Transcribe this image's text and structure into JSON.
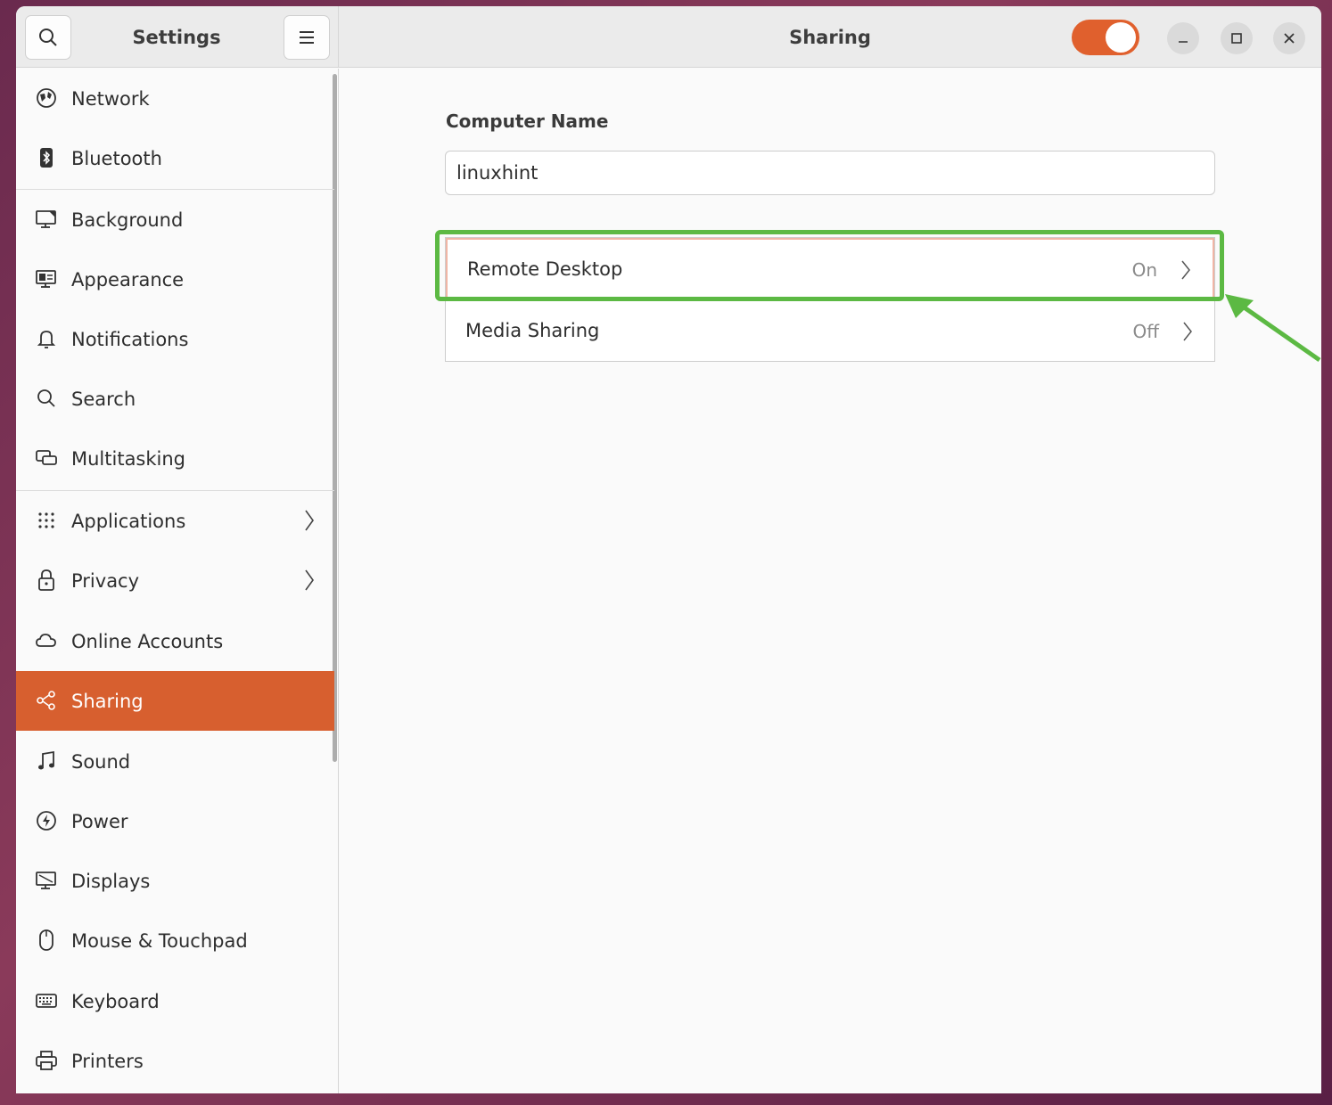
{
  "sidebar": {
    "title": "Settings",
    "items": [
      {
        "label": "Network",
        "icon": "network-icon"
      },
      {
        "label": "Bluetooth",
        "icon": "bluetooth-icon"
      },
      {
        "label": "Background",
        "icon": "background-icon"
      },
      {
        "label": "Appearance",
        "icon": "appearance-icon"
      },
      {
        "label": "Notifications",
        "icon": "bell-icon"
      },
      {
        "label": "Search",
        "icon": "search-icon"
      },
      {
        "label": "Multitasking",
        "icon": "multitasking-icon"
      },
      {
        "label": "Applications",
        "icon": "grid-icon"
      },
      {
        "label": "Privacy",
        "icon": "lock-icon"
      },
      {
        "label": "Online Accounts",
        "icon": "cloud-icon"
      },
      {
        "label": "Sharing",
        "icon": "share-icon"
      },
      {
        "label": "Sound",
        "icon": "music-note-icon"
      },
      {
        "label": "Power",
        "icon": "power-icon"
      },
      {
        "label": "Displays",
        "icon": "display-icon"
      },
      {
        "label": "Mouse & Touchpad",
        "icon": "mouse-icon"
      },
      {
        "label": "Keyboard",
        "icon": "keyboard-icon"
      },
      {
        "label": "Printers",
        "icon": "printer-icon"
      }
    ],
    "active": "Sharing"
  },
  "header": {
    "title": "Sharing",
    "sharing_toggle": "on",
    "accent_color": "#e0602d"
  },
  "main": {
    "computer_name_label": "Computer Name",
    "computer_name_value": "linuxhint",
    "rows": [
      {
        "label": "Remote Desktop",
        "value": "On"
      },
      {
        "label": "Media Sharing",
        "value": "Off"
      }
    ]
  },
  "annotation": {
    "highlight_color": "#5cb943"
  }
}
